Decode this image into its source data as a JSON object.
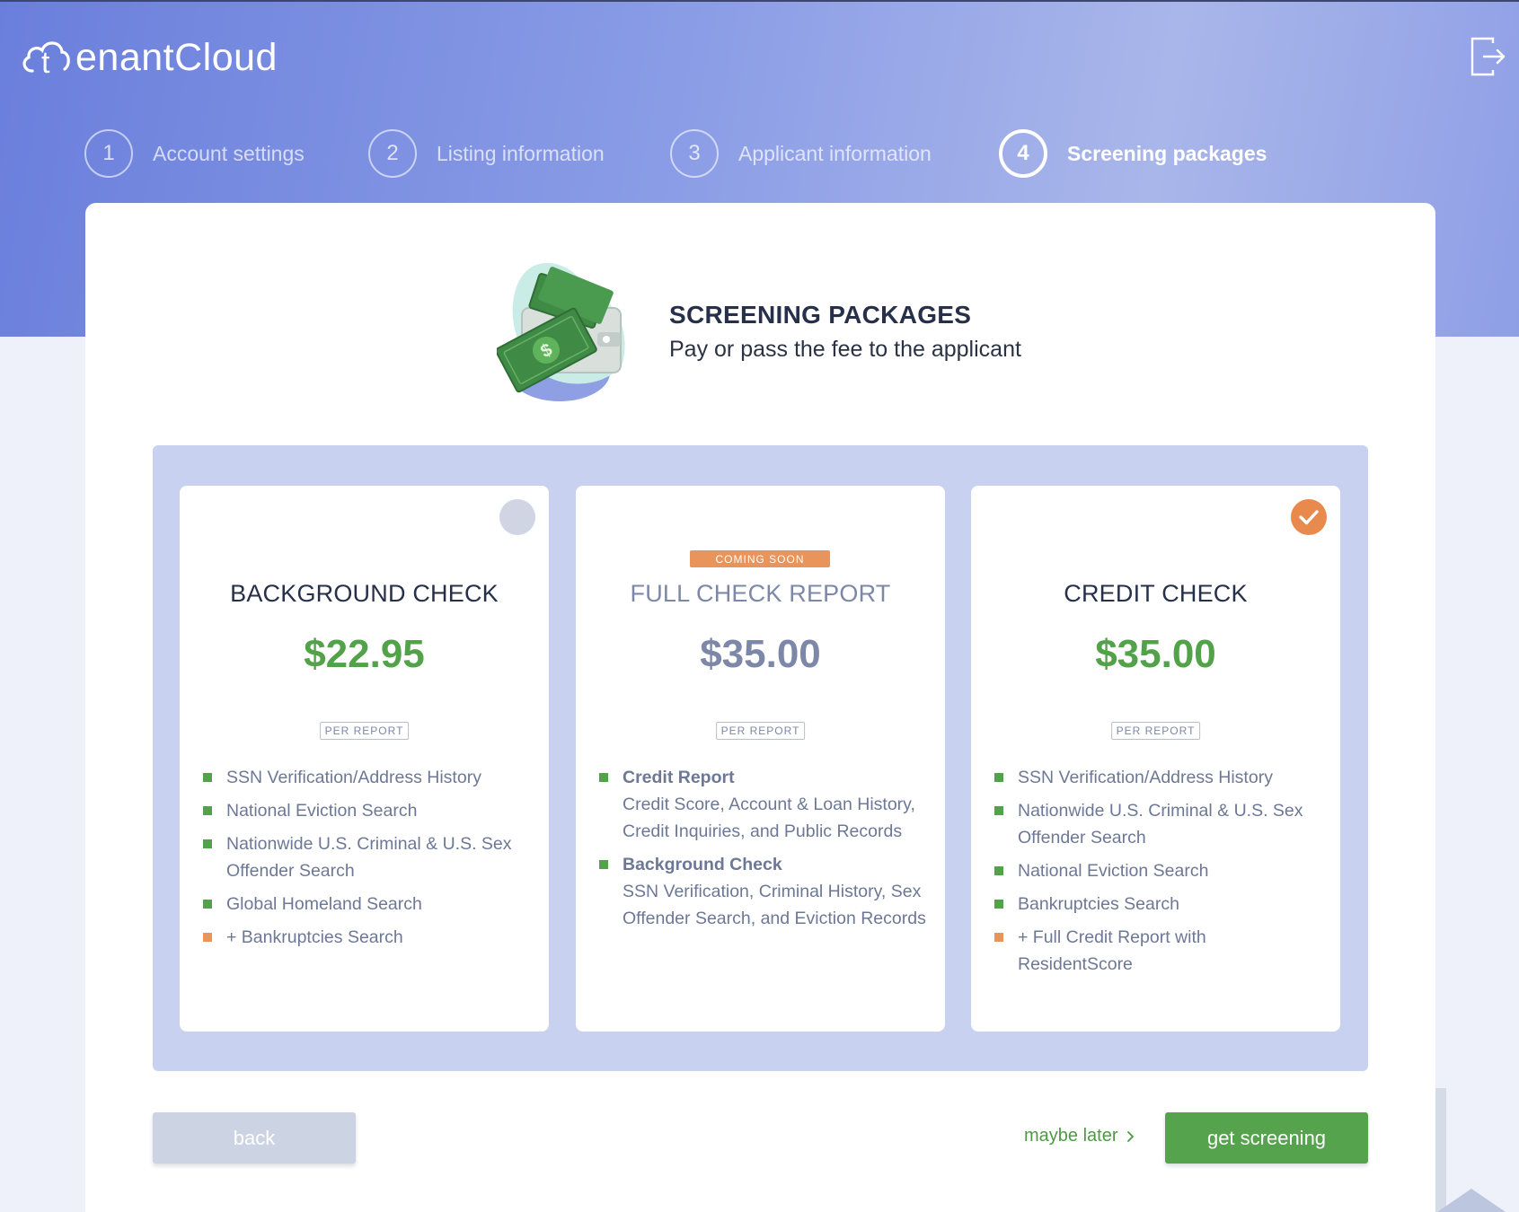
{
  "app": {
    "logo_text": "enantCloud",
    "logo_letter": "t"
  },
  "steps": [
    {
      "number": "1",
      "label": "Account settings",
      "active": false
    },
    {
      "number": "2",
      "label": "Listing information",
      "active": false
    },
    {
      "number": "3",
      "label": "Applicant information",
      "active": false
    },
    {
      "number": "4",
      "label": "Screening packages",
      "active": true
    }
  ],
  "intro": {
    "title": "SCREENING PACKAGES",
    "subtitle": "Pay or pass the fee to the applicant"
  },
  "packages": [
    {
      "title": "BACKGROUND CHECK",
      "price": "$22.95",
      "per": "PER REPORT",
      "selected": false,
      "features": [
        {
          "text": "SSN Verification/Address History",
          "extra": false
        },
        {
          "text": "National Eviction Search",
          "extra": false
        },
        {
          "text": "Nationwide U.S. Criminal & U.S. Sex Offender Search",
          "extra": false
        },
        {
          "text": "Global Homeland Search",
          "extra": false
        },
        {
          "text": "+ Bankruptcies Search",
          "extra": true
        }
      ]
    },
    {
      "badge": "COMING SOON",
      "title": "FULL CHECK REPORT",
      "price": "$35.00",
      "per": "PER REPORT",
      "features": [
        {
          "head": "Credit Report",
          "desc": "Credit Score, Account & Loan History, Credit Inquiries, and Public Records"
        },
        {
          "head": "Background Check",
          "desc": "SSN Verification, Criminal History, Sex Offender Search, and Eviction Records"
        }
      ]
    },
    {
      "title": "CREDIT CHECK",
      "price": "$35.00",
      "per": "PER REPORT",
      "selected": true,
      "features": [
        {
          "text": "SSN Verification/Address History",
          "extra": false
        },
        {
          "text": "Nationwide U.S. Criminal & U.S. Sex Offender Search",
          "extra": false
        },
        {
          "text": "National Eviction Search",
          "extra": false
        },
        {
          "text": "Bankruptcies Search",
          "extra": false
        },
        {
          "text": "+ Full Credit Report with ResidentScore",
          "extra": true
        }
      ]
    }
  ],
  "actions": {
    "back": "back",
    "maybe_later": "maybe later",
    "get_screening": "get screening"
  },
  "colors": {
    "accent_green": "#52a24a",
    "accent_orange": "#e8945a",
    "header_gradient_start": "#6a7fdc",
    "packages_bg": "#c8d1f0"
  },
  "icons": {
    "logo": "cloud-logo-icon",
    "logout": "logout-icon",
    "selected_check": "check-icon",
    "illustration": "wallet-money-icon",
    "maybe_later_arrow": "chevron-right-icon"
  }
}
